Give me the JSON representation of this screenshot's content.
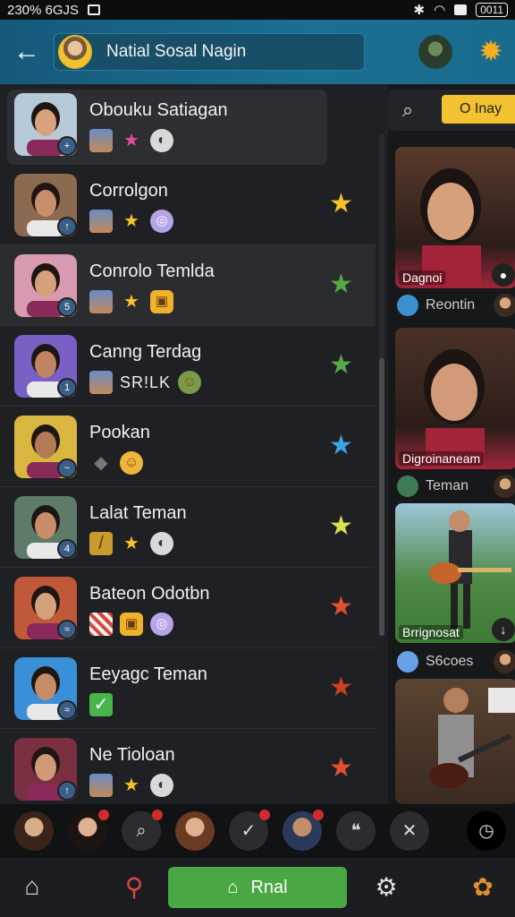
{
  "statusbar": {
    "left_text": "230% 6GJS",
    "battery": "0011"
  },
  "header": {
    "title": "Natial Sosal Nagin"
  },
  "contacts": [
    {
      "name": "Obouku Satiagan",
      "badge": "+",
      "icons": [
        "mini-face",
        "pink-star",
        "round-icon"
      ],
      "star": null
    },
    {
      "name": "Corrolgon",
      "badge": "↑",
      "icons": [
        "mini-face",
        "star",
        "lavender-icon"
      ],
      "star": "#f6c22c"
    },
    {
      "name": "Conrolo Temlda",
      "badge": "5",
      "icons": [
        "mini-face",
        "star",
        "gold-icon"
      ],
      "star": "#58a947"
    },
    {
      "name": "Canng Terdag",
      "badge": "1",
      "icons": [
        "mini-face"
      ],
      "tag": "SR!LK",
      "star": "#58a947"
    },
    {
      "name": "Pookan",
      "badge": "~",
      "icons": [
        "gray-icon",
        "emoji-icon"
      ],
      "star": "#3ba6e6"
    },
    {
      "name": "Lalat Teman",
      "badge": "4",
      "icons": [
        "brush-icon",
        "star",
        "round-icon"
      ],
      "star": "#d8e24a"
    },
    {
      "name": "Bateon Odotbn",
      "badge": "≈",
      "icons": [
        "flag-icon",
        "gold-icon",
        "lavender-icon"
      ],
      "star": "#e0522f"
    },
    {
      "name": "Eeyagc Teman",
      "badge": "≈",
      "icons": [
        "check-icon"
      ],
      "star": "#c8421f"
    },
    {
      "name": "Ne Tioloan",
      "badge": "↑",
      "icons": [
        "mini-face",
        "star",
        "round-icon"
      ],
      "star": "#e0522f"
    }
  ],
  "side": {
    "button": "O Inay",
    "cards": [
      {
        "caption": "Dagnoi"
      },
      {
        "caption": "Digroinaneam"
      },
      {
        "caption": "Brrignosat"
      },
      {
        "caption": ""
      }
    ],
    "labels": [
      "Reontin",
      "Teman",
      "S6coes"
    ]
  },
  "bottom": {
    "primary_label": "Rnal"
  }
}
